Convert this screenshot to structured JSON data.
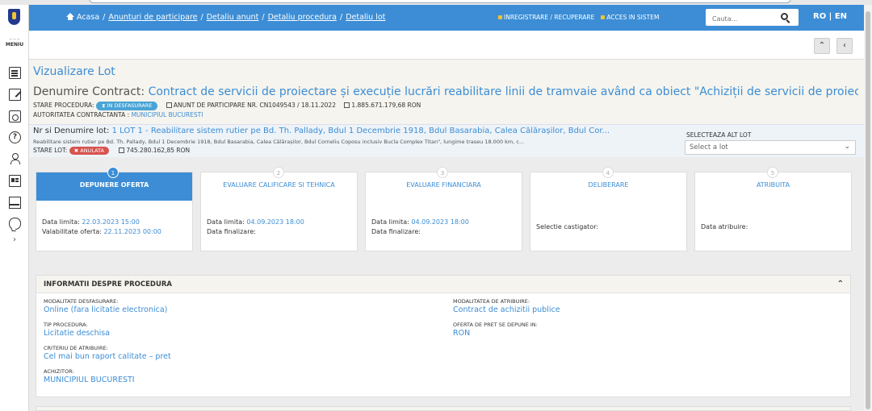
{
  "nav": {
    "breadcrumb": [
      "Acasa",
      "Anunturi de participare",
      "Detaliu anunt",
      "Detaliu procedura",
      "Detaliu lot"
    ],
    "register_link": "INREGISTRARE / RECUPERARE",
    "login_link": "ACCES IN SISTEM",
    "search_placeholder": "Cauta...",
    "lang": "RO | EN"
  },
  "sidebar": {
    "menu_label": "MENIU",
    "icons": [
      "document-icon",
      "edit-document-icon",
      "briefcase-icon",
      "help-icon",
      "user-icon",
      "id-card-icon",
      "register-icon",
      "chat-icon"
    ],
    "expand": "›"
  },
  "header": {
    "title": "Vizualizare Lot",
    "contract_label": "Denumire Contract:",
    "contract_value": "Contract de servicii de proiectare și execuție lucrări reabilitare linii de tramvaie având ca obiect \"Achiziții de servicii de proiectare, asistență teh...",
    "status_label": "STARE PROCEDURA:",
    "status_badge": "IN DESFASURARE",
    "notice": "ANUNT DE PARTICIPARE NR. CN1049543 / 18.11.2022",
    "value": "1.885.671.179,68  RON",
    "authority_label": "AUTORITATEA CONTRACTANTA :",
    "authority_value": "MUNICIPIUL BUCURESTI"
  },
  "lot": {
    "label": "Nr si Denumire lot:",
    "value": "1 LOT 1 - Reabilitare sistem rutier pe Bd. Th. Pallady, Bdul 1 Decembrie 1918, Bdul Basarabia, Calea Călărașilor, Bdul Cor...",
    "description": "Reabilitare sistem rutier pe Bd. Th. Pallady, Bdul 1 Decembrie 1918, Bdul Basarabia, Calea Călărașilor, Bdul Corneliu Coposu inclusiv Bucla Complex Titan\", lungime traseu 18.000 km, c...",
    "status_label": "STARE LOT:",
    "status_badge": "ANULATA",
    "lot_value": "745.280.162,85  RON",
    "select_label": "SELECTEAZA ALT LOT",
    "select_placeholder": "Select a lot"
  },
  "steps": [
    {
      "num": "1",
      "title": "DEPUNERE OFERTA",
      "l1": "Data limita:",
      "v1": "22.03.2023 15:00",
      "l2": "Valabilitate oferta:",
      "v2": "22.11.2023 00:00"
    },
    {
      "num": "2",
      "title": "EVALUARE CALIFICARE SI TEHNICA",
      "l1": "Data limita:",
      "v1": "04.09.2023 18:00",
      "l2": "Data finalizare:",
      "v2": ""
    },
    {
      "num": "3",
      "title": "EVALUARE FINANCIARA",
      "l1": "Data limita:",
      "v1": "04.09.2023 18:00",
      "l2": "Data finalizare:",
      "v2": ""
    },
    {
      "num": "4",
      "title": "DELIBERARE",
      "l1": "Selectie castigator:",
      "v1": ""
    },
    {
      "num": "5",
      "title": "ATRIBUITA",
      "l1": "Data atribuire:",
      "v1": ""
    }
  ],
  "info": {
    "title": "INFORMATII DESPRE PROCEDURA",
    "fields_left": [
      {
        "label": "MODALITATE DESFASURARE:",
        "value": "Online (fara licitatie electronica)"
      },
      {
        "label": "TIP PROCEDURA:",
        "value": "Licitatie deschisa"
      },
      {
        "label": "CRITERIU DE ATRIBUIRE:",
        "value": "Cel mai bun raport calitate – pret"
      },
      {
        "label": "ACHIZITOR:",
        "value": "MUNICIPIUL BUCURESTI"
      }
    ],
    "fields_right": [
      {
        "label": "MODALITATEA DE ATRIBUIRE:",
        "value": "Contract de achizitii publice"
      },
      {
        "label": "OFERTA DE PRET SE DEPUNE IN:",
        "value": "RON"
      }
    ]
  },
  "colors": {
    "accent": "#3c8dd5",
    "danger": "#d9534f",
    "badge": "#4aa4d6",
    "header_bg": "#f5f4ee"
  }
}
